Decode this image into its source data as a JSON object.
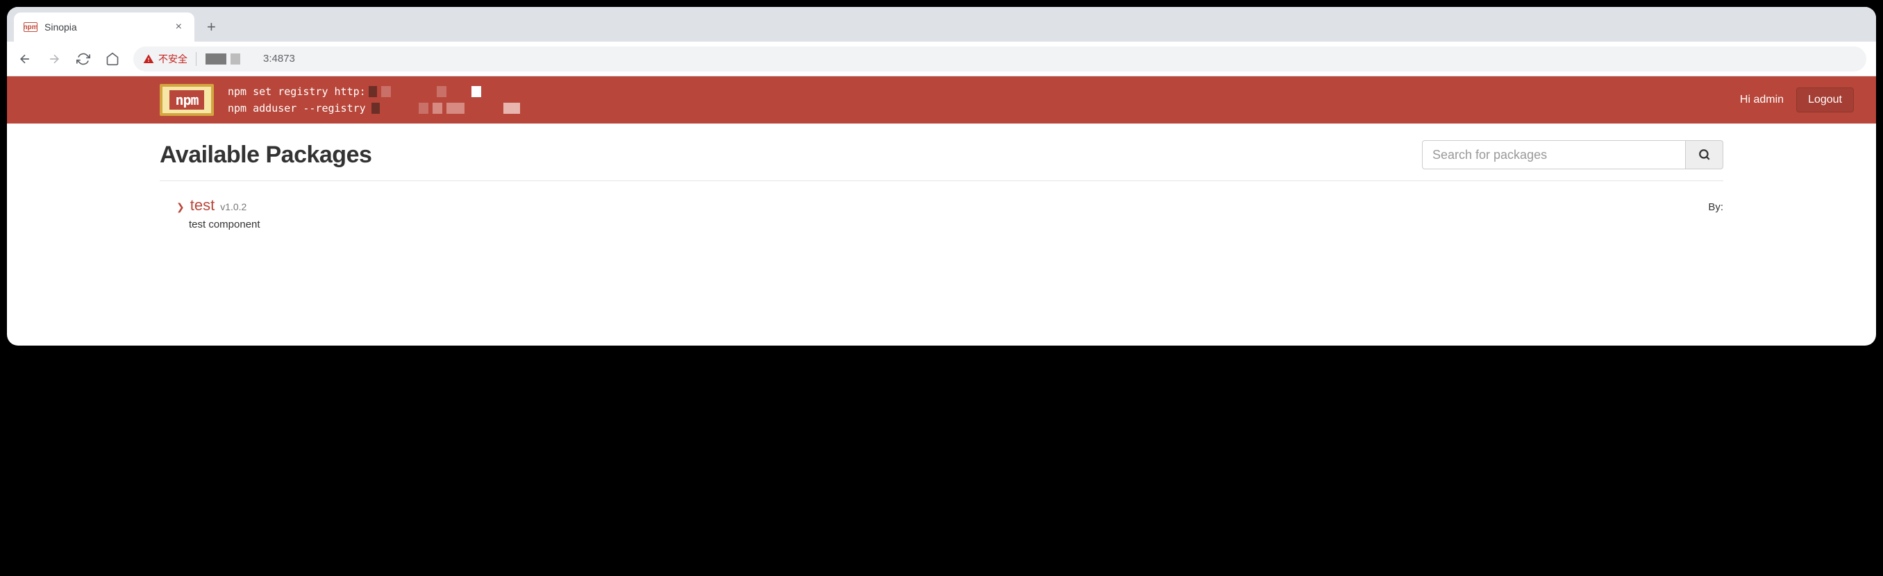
{
  "browser": {
    "tab_title": "Sinopia",
    "tab_favicon_text": "npm",
    "insecure_label": "不安全",
    "url_suffix": "3:4873"
  },
  "header": {
    "logo_text": "npm",
    "cmd1": "npm set registry http:",
    "cmd2": "npm adduser --registry",
    "greeting": "Hi admin",
    "logout_label": "Logout"
  },
  "main": {
    "title": "Available Packages",
    "search_placeholder": "Search for packages"
  },
  "package": {
    "name": "test",
    "version": "v1.0.2",
    "by_label": "By:",
    "description": "test component"
  }
}
